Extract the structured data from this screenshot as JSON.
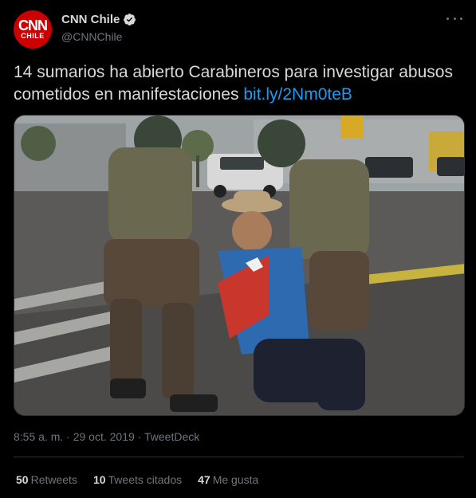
{
  "account": {
    "display_name": "CNN Chile",
    "handle": "@CNNChile",
    "avatar_logo_main": "CNN",
    "avatar_logo_sub": "CHILE",
    "avatar_color": "#cc0000"
  },
  "tweet": {
    "text": "14 sumarios ha abierto Carabineros para investigar abusos cometidos en manifestaciones",
    "link_text": "bit.ly/2Nm0teB",
    "image_alt": "",
    "time": "8:55 a. m.",
    "date": "29 oct. 2019",
    "source": "TweetDeck"
  },
  "stats": {
    "retweets_count": "50",
    "retweets_label": "Retweets",
    "quotes_count": "10",
    "quotes_label": "Tweets citados",
    "likes_count": "47",
    "likes_label": "Me gusta"
  },
  "icons": {
    "verified": "verified-badge-icon",
    "more": "more-options-icon"
  },
  "colors": {
    "background": "#000000",
    "link": "#1d9bf0",
    "secondary_text": "#6e767d",
    "primary_text": "#d9d9d9"
  }
}
